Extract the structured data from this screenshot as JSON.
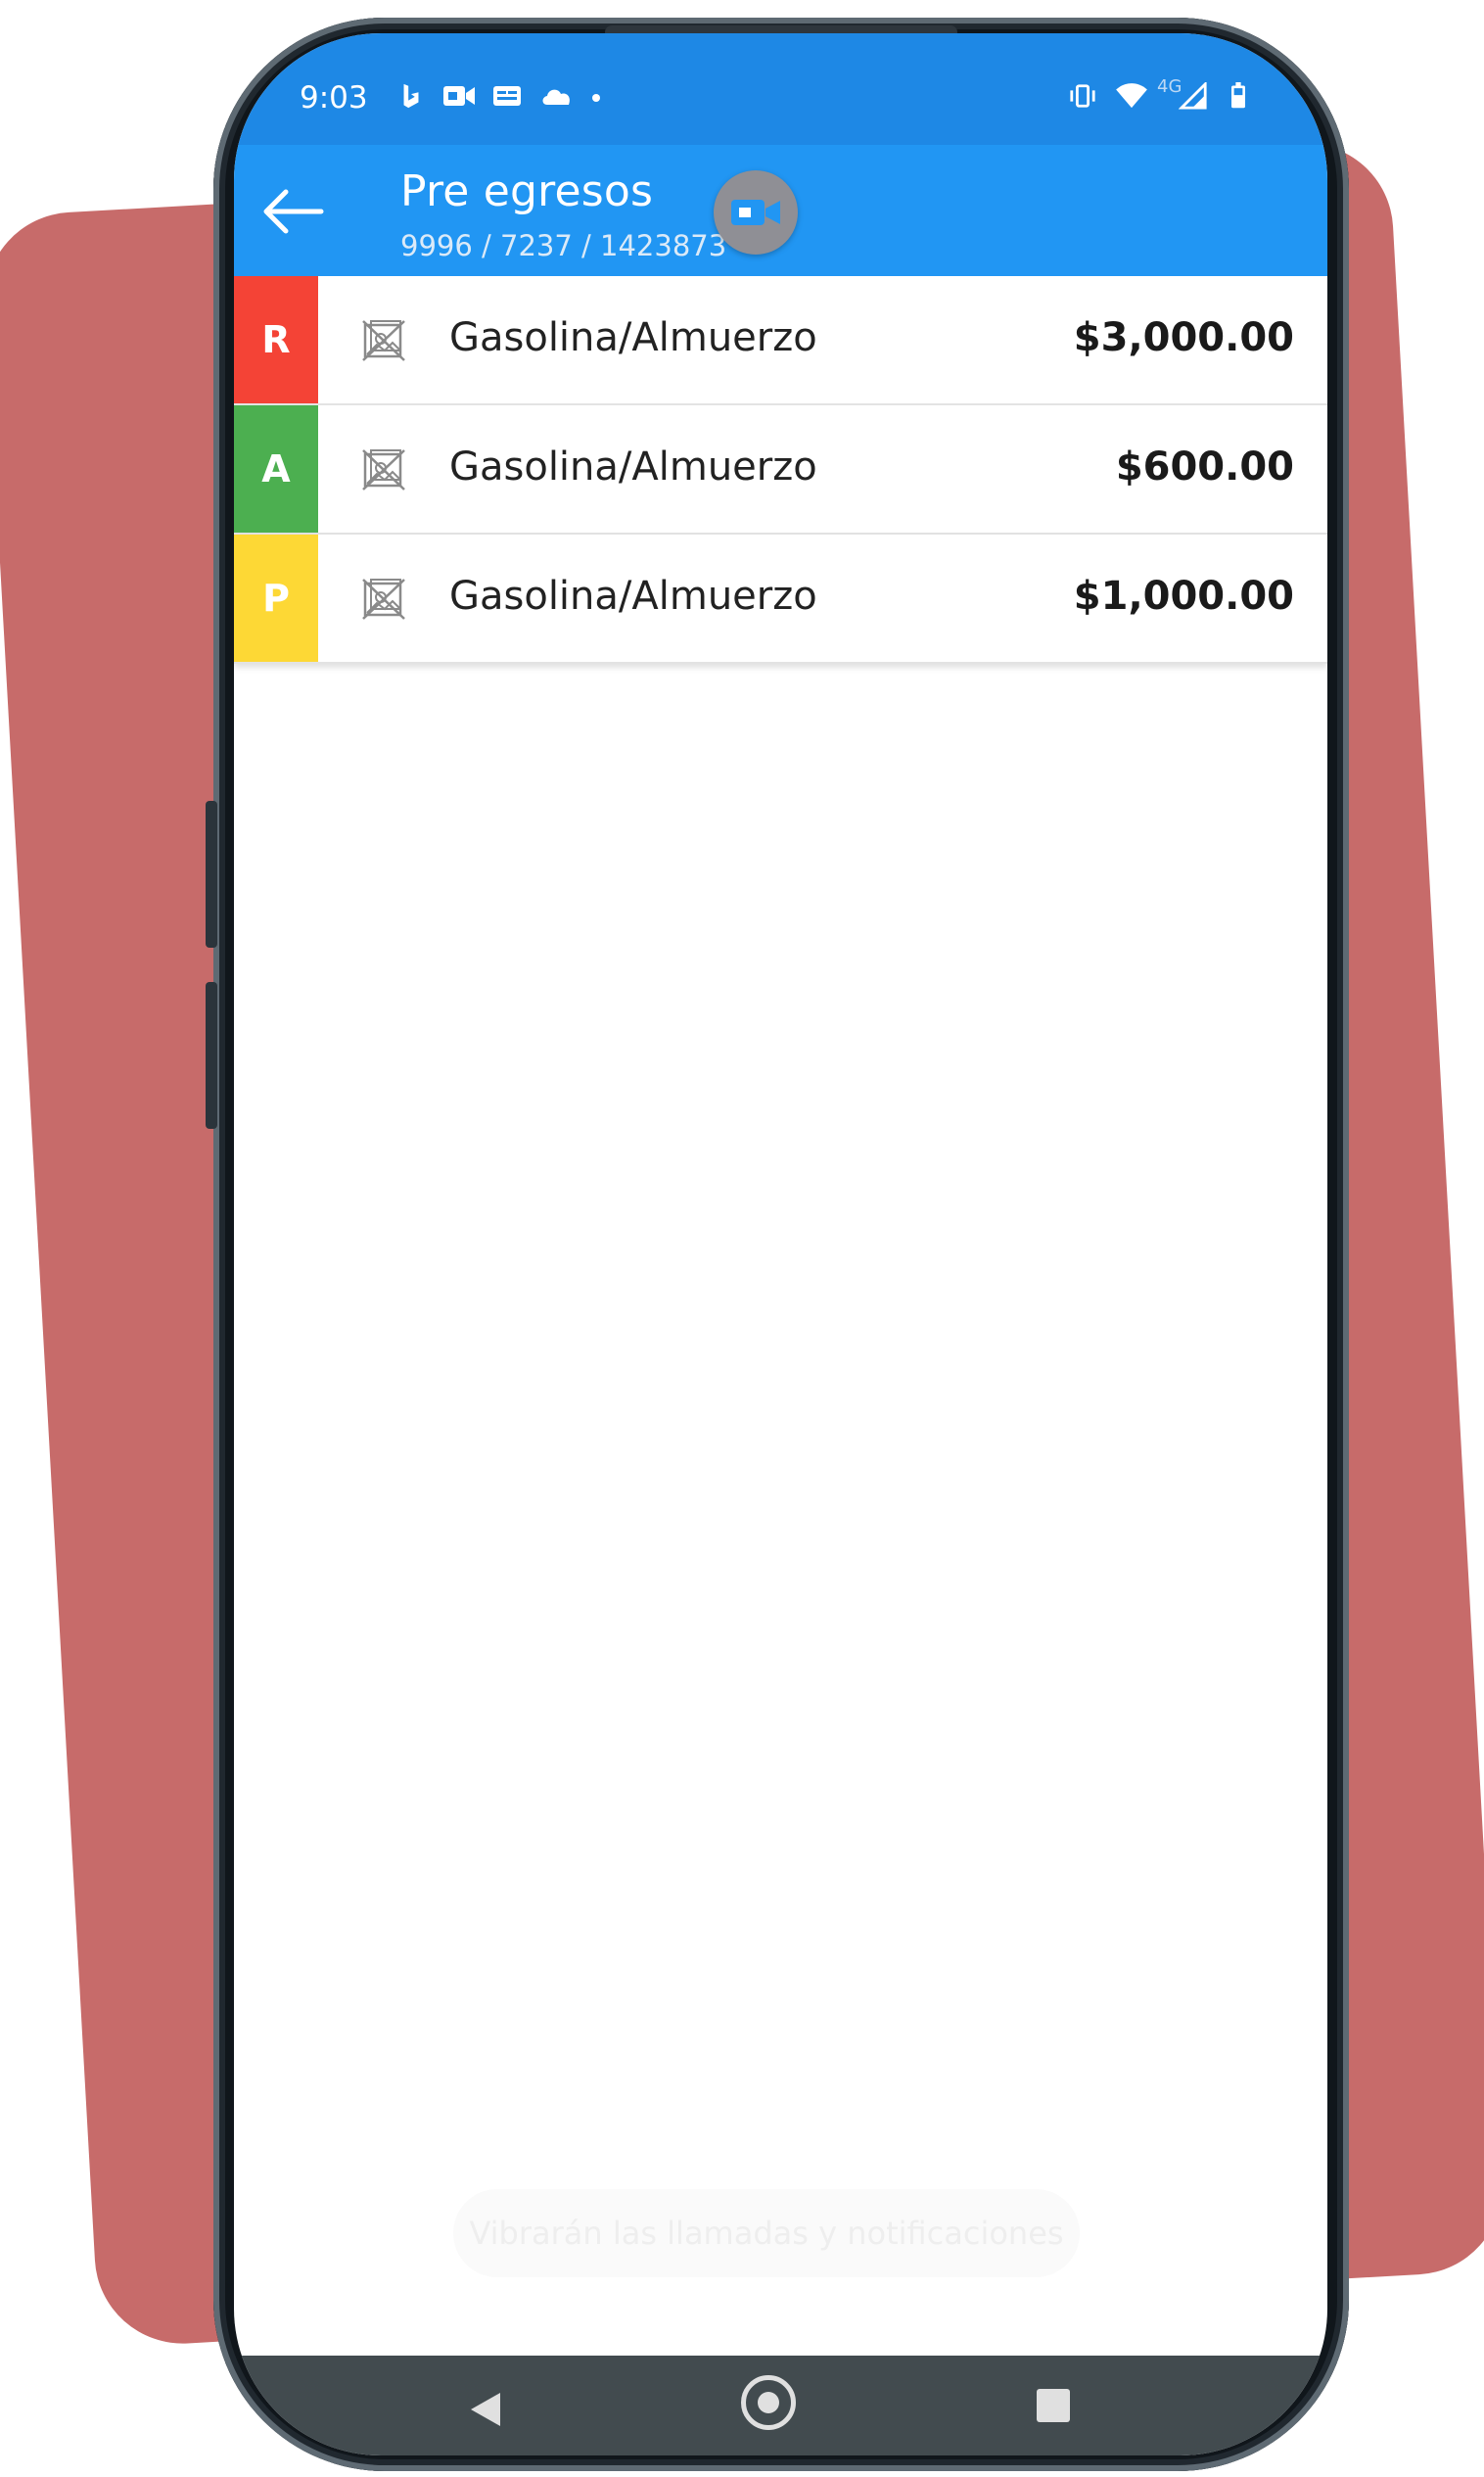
{
  "status_bar": {
    "time": "9:03",
    "icons_left": [
      "bing-icon",
      "video-call-icon",
      "gmail-icon",
      "cloud-icon",
      "dot-icon"
    ],
    "icons_right": [
      "vibrate-icon",
      "wifi-icon",
      "signal-4g-icon",
      "battery-icon"
    ],
    "network_label": "4G"
  },
  "appbar": {
    "title": "Pre egresos",
    "subtitle": "9996 / 7237 / 1423873",
    "color": "#2196f3"
  },
  "expenses": [
    {
      "letter": "R",
      "color": "#f44336",
      "label": "Gasolina/Almuerzo",
      "amount": "$3,000.00"
    },
    {
      "letter": "A",
      "color": "#4caf50",
      "label": "Gasolina/Almuerzo",
      "amount": "$600.00"
    },
    {
      "letter": "P",
      "color": "#fdd835",
      "label": "Gasolina/Almuerzo",
      "amount": "$1,000.00"
    }
  ],
  "toast": {
    "text": "Vibrarán las llamadas y notificaciones"
  },
  "colors": {
    "background_card": "#c76b6a",
    "status_bar": "#1e88e5",
    "nav_bar": "#424b4f"
  }
}
